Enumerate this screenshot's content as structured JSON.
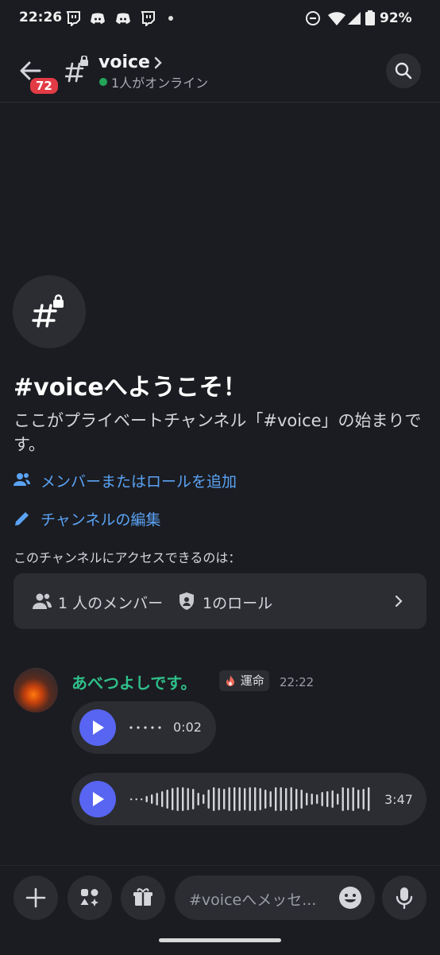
{
  "status_bar": {
    "time": "22:26",
    "battery": "92%"
  },
  "header": {
    "unread_badge": "72",
    "channel_name": "voice",
    "online_status": "1人がオンライン"
  },
  "welcome": {
    "title": "#voiceへようこそ！",
    "description": "ここがプライベートチャンネル「#voice」の始まりです。",
    "add_members_link": "メンバーまたはロールを追加",
    "edit_channel_link": "チャンネルの編集",
    "access_label": "このチャンネルにアクセスできるのは：",
    "members_count": "1 人のメンバー",
    "roles_count": "1のロール"
  },
  "message": {
    "author": "あべつよしです。",
    "role_tag": "運命",
    "timestamp": "22:22",
    "voice_messages": [
      {
        "duration": "0:02"
      },
      {
        "duration": "3:47"
      }
    ]
  },
  "composer": {
    "placeholder": "#voiceへメッセ..."
  },
  "colors": {
    "accent": "#5865f2",
    "link": "#5aa3f5",
    "author": "#2fbf8a",
    "online": "#23a55a",
    "badge": "#e23b45"
  }
}
